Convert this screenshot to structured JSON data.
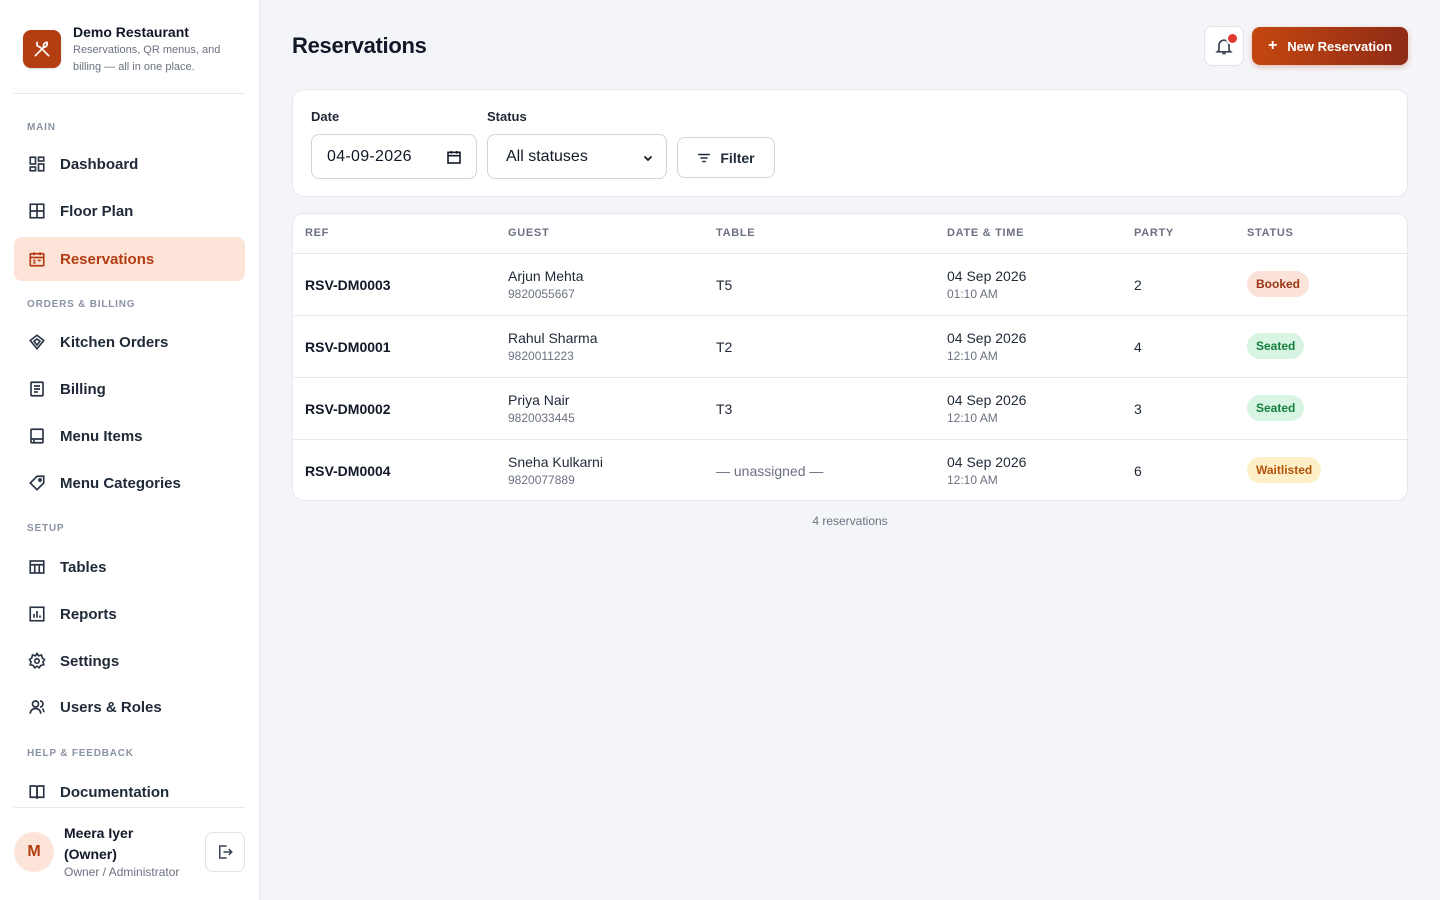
{
  "brand": {
    "name": "Demo Restaurant",
    "tagline": "Reservations, QR menus, and billing — all in one place."
  },
  "sidebar": {
    "sections": {
      "main": "MAIN",
      "orders": "ORDERS & BILLING",
      "setup": "SETUP",
      "help": "HELP & FEEDBACK"
    },
    "items": [
      {
        "label": "Dashboard",
        "icon": "dashboard-icon"
      },
      {
        "label": "Floor Plan",
        "icon": "floor-plan-icon"
      },
      {
        "label": "Reservations",
        "icon": "calendar-icon",
        "active": true
      },
      {
        "label": "Kitchen Orders",
        "icon": "kitchen-icon"
      },
      {
        "label": "Billing",
        "icon": "receipt-icon"
      },
      {
        "label": "Menu Items",
        "icon": "book-icon"
      },
      {
        "label": "Menu Categories",
        "icon": "tag-icon"
      },
      {
        "label": "Tables",
        "icon": "table-icon"
      },
      {
        "label": "Reports",
        "icon": "chart-icon"
      },
      {
        "label": "Settings",
        "icon": "gear-icon"
      },
      {
        "label": "Users & Roles",
        "icon": "users-icon"
      },
      {
        "label": "Documentation",
        "icon": "docs-icon"
      }
    ]
  },
  "user": {
    "initial": "M",
    "name": "Meera Iyer (Owner)",
    "role": "Owner / Administrator"
  },
  "header": {
    "title": "Reservations",
    "new_button": "New Reservation",
    "new_button_icon": "+"
  },
  "filters": {
    "date_label": "Date",
    "date_value": "04-09-2026",
    "status_label": "Status",
    "status_value": "All statuses",
    "filter_button": "Filter"
  },
  "table": {
    "columns": [
      "REF",
      "GUEST",
      "TABLE",
      "DATE & TIME",
      "PARTY",
      "STATUS"
    ],
    "rows": [
      {
        "ref": "RSV-DM0003",
        "guest": "Arjun Mehta",
        "phone": "9820055667",
        "table": "T5",
        "date": "04 Sep 2026",
        "time": "01:10 AM",
        "party": "2",
        "status": "Booked"
      },
      {
        "ref": "RSV-DM0001",
        "guest": "Rahul Sharma",
        "phone": "9820011223",
        "table": "T2",
        "date": "04 Sep 2026",
        "time": "12:10 AM",
        "party": "4",
        "status": "Seated"
      },
      {
        "ref": "RSV-DM0002",
        "guest": "Priya Nair",
        "phone": "9820033445",
        "table": "T3",
        "date": "04 Sep 2026",
        "time": "12:10 AM",
        "party": "3",
        "status": "Seated"
      },
      {
        "ref": "RSV-DM0004",
        "guest": "Sneha Kulkarni",
        "phone": "9820077889",
        "table": "— unassigned —",
        "date": "04 Sep 2026",
        "time": "12:10 AM",
        "party": "6",
        "status": "Waitlisted"
      }
    ],
    "count_text": "4 reservations"
  },
  "colors": {
    "accent": "#b33d13",
    "booked": "#9a3412",
    "seated": "#15803d",
    "waitlisted": "#b45309"
  }
}
